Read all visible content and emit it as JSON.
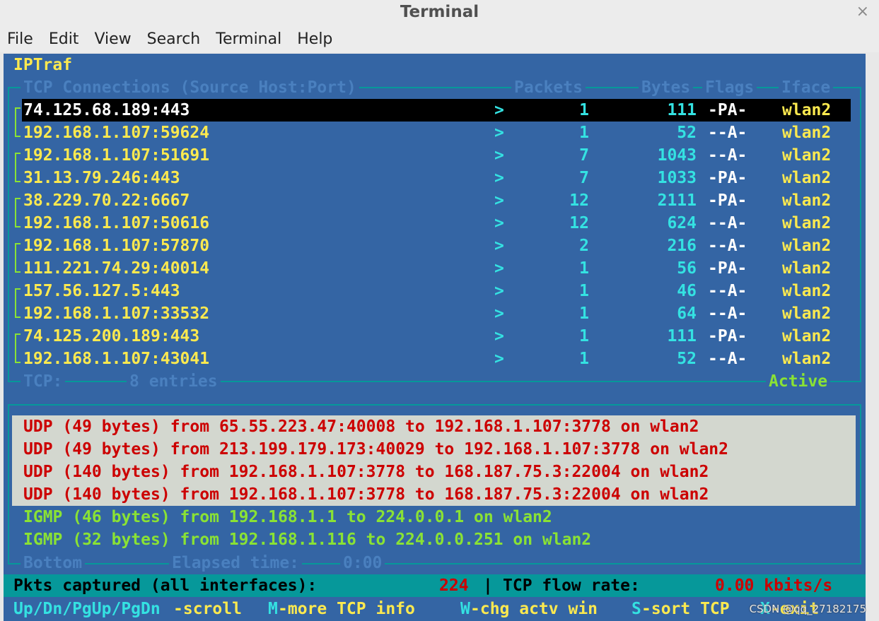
{
  "window": {
    "title": "Terminal",
    "close_glyph": "×"
  },
  "menu": [
    "File",
    "Edit",
    "View",
    "Search",
    "Terminal",
    "Help"
  ],
  "app": {
    "title": "IPTraf"
  },
  "tcp": {
    "headers": {
      "connections": "TCP Connections (Source Host:Port)",
      "packets": "Packets",
      "bytes": "Bytes",
      "flags": "Flags",
      "iface": "Iface"
    },
    "rows": [
      {
        "addr": "74.125.68.189:443",
        "dir": ">",
        "packets": "1",
        "bytes": "111",
        "flags": "-PA-",
        "iface": "wlan2",
        "selected": true
      },
      {
        "addr": "192.168.1.107:59624",
        "dir": ">",
        "packets": "1",
        "bytes": "52",
        "flags": "--A-",
        "iface": "wlan2"
      },
      {
        "addr": "192.168.1.107:51691",
        "dir": ">",
        "packets": "7",
        "bytes": "1043",
        "flags": "--A-",
        "iface": "wlan2"
      },
      {
        "addr": "31.13.79.246:443",
        "dir": ">",
        "packets": "7",
        "bytes": "1033",
        "flags": "-PA-",
        "iface": "wlan2"
      },
      {
        "addr": "38.229.70.22:6667",
        "dir": ">",
        "packets": "12",
        "bytes": "2111",
        "flags": "-PA-",
        "iface": "wlan2"
      },
      {
        "addr": "192.168.1.107:50616",
        "dir": ">",
        "packets": "12",
        "bytes": "624",
        "flags": "--A-",
        "iface": "wlan2"
      },
      {
        "addr": "192.168.1.107:57870",
        "dir": ">",
        "packets": "2",
        "bytes": "216",
        "flags": "--A-",
        "iface": "wlan2"
      },
      {
        "addr": "111.221.74.29:40014",
        "dir": ">",
        "packets": "1",
        "bytes": "56",
        "flags": "-PA-",
        "iface": "wlan2"
      },
      {
        "addr": "157.56.127.5:443",
        "dir": ">",
        "packets": "1",
        "bytes": "46",
        "flags": "--A-",
        "iface": "wlan2"
      },
      {
        "addr": "192.168.1.107:33532",
        "dir": ">",
        "packets": "1",
        "bytes": "64",
        "flags": "--A-",
        "iface": "wlan2"
      },
      {
        "addr": "74.125.200.189:443",
        "dir": ">",
        "packets": "1",
        "bytes": "111",
        "flags": "-PA-",
        "iface": "wlan2"
      },
      {
        "addr": "192.168.1.107:43041",
        "dir": ">",
        "packets": "1",
        "bytes": "52",
        "flags": "--A-",
        "iface": "wlan2"
      }
    ],
    "footer_label": "TCP:",
    "footer_entries": "8 entries",
    "footer_state": "Active"
  },
  "other": {
    "udp_lines": [
      "UDP (49 bytes) from 65.55.223.47:40008 to 192.168.1.107:3778 on wlan2",
      "UDP (49 bytes) from 213.199.179.173:40029 to 192.168.1.107:3778 on wlan2",
      "UDP (140 bytes) from 192.168.1.107:3778 to 168.187.75.3:22004 on wlan2",
      "UDP (140 bytes) from 192.168.1.107:3778 to 168.187.75.3:22004 on wlan2"
    ],
    "igmp_lines": [
      "IGMP (46 bytes) from 192.168.1.1 to 224.0.0.1 on wlan2",
      "IGMP (32 bytes) from 192.168.1.116 to 224.0.0.251 on wlan2"
    ],
    "footer_bottom": "Bottom",
    "footer_elapsed": "Elapsed time:",
    "footer_time": "0:00"
  },
  "status": {
    "pkts_label": "Pkts captured (all interfaces):",
    "pkts_value": "224",
    "sep": "|",
    "flow_label": "TCP flow rate:",
    "flow_value": "0.00 kbits/s"
  },
  "help": {
    "k1": "Up/Dn/PgUp/PgDn",
    "t1": "-scroll",
    "k2": "M",
    "t2": "-more TCP info",
    "k3": "W",
    "t3": "-chg actv win",
    "k4": "S",
    "t4": "-sort TCP",
    "k5": "X",
    "t5": "-exit"
  },
  "watermark": "CSDN @qq_27182175",
  "colors": {
    "term_bg": "#3465a4",
    "yellow": "#fce94f",
    "cyan": "#34e2e2",
    "green": "#8ae234",
    "red": "#cc0000",
    "border": "#06989a"
  }
}
